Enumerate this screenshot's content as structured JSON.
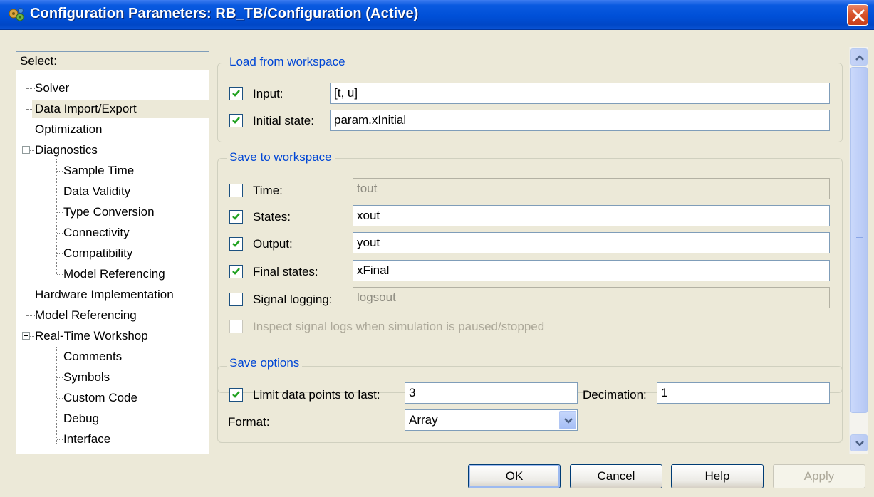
{
  "window": {
    "title": "Configuration Parameters: RB_TB/Configuration (Active)"
  },
  "tree": {
    "header": "Select:",
    "items": [
      {
        "label": "Solver"
      },
      {
        "label": "Data Import/Export",
        "selected": true
      },
      {
        "label": "Optimization"
      },
      {
        "label": "Diagnostics",
        "expanded": true
      },
      {
        "label": "Sample Time"
      },
      {
        "label": "Data Validity"
      },
      {
        "label": "Type Conversion"
      },
      {
        "label": "Connectivity"
      },
      {
        "label": "Compatibility"
      },
      {
        "label": "Model Referencing"
      },
      {
        "label": "Hardware Implementation"
      },
      {
        "label": "Model Referencing"
      },
      {
        "label": "Real-Time Workshop",
        "expanded": true
      },
      {
        "label": "Comments"
      },
      {
        "label": "Symbols"
      },
      {
        "label": "Custom Code"
      },
      {
        "label": "Debug"
      },
      {
        "label": "Interface"
      }
    ]
  },
  "load_from_workspace": {
    "title": "Load from workspace",
    "input": {
      "label": "Input:",
      "checked": true,
      "value": "[t, u]"
    },
    "initial_state": {
      "label": "Initial state:",
      "checked": true,
      "value": "param.xInitial"
    }
  },
  "save_to_workspace": {
    "title": "Save to workspace",
    "time": {
      "label": "Time:",
      "checked": false,
      "value": "tout",
      "enabled": false
    },
    "states": {
      "label": "States:",
      "checked": true,
      "value": "xout"
    },
    "output": {
      "label": "Output:",
      "checked": true,
      "value": "yout"
    },
    "final_states": {
      "label": "Final states:",
      "checked": true,
      "value": "xFinal"
    },
    "signal_logging": {
      "label": "Signal logging:",
      "checked": false,
      "value": "logsout",
      "enabled": false
    },
    "inspect": {
      "label": "Inspect signal logs when simulation is paused/stopped",
      "checked": false,
      "enabled": false
    }
  },
  "save_options": {
    "title": "Save options",
    "limit": {
      "label": "Limit data points to last:",
      "checked": true,
      "value": "3"
    },
    "decimation": {
      "label": "Decimation:",
      "value": "1"
    },
    "format": {
      "label": "Format:",
      "value": "Array"
    }
  },
  "buttons": {
    "ok": "OK",
    "cancel": "Cancel",
    "help": "Help",
    "apply": "Apply"
  },
  "colors": {
    "titlebar": "#0050d8",
    "group_title": "#0046d5",
    "window_bg": "#ece9d8"
  }
}
